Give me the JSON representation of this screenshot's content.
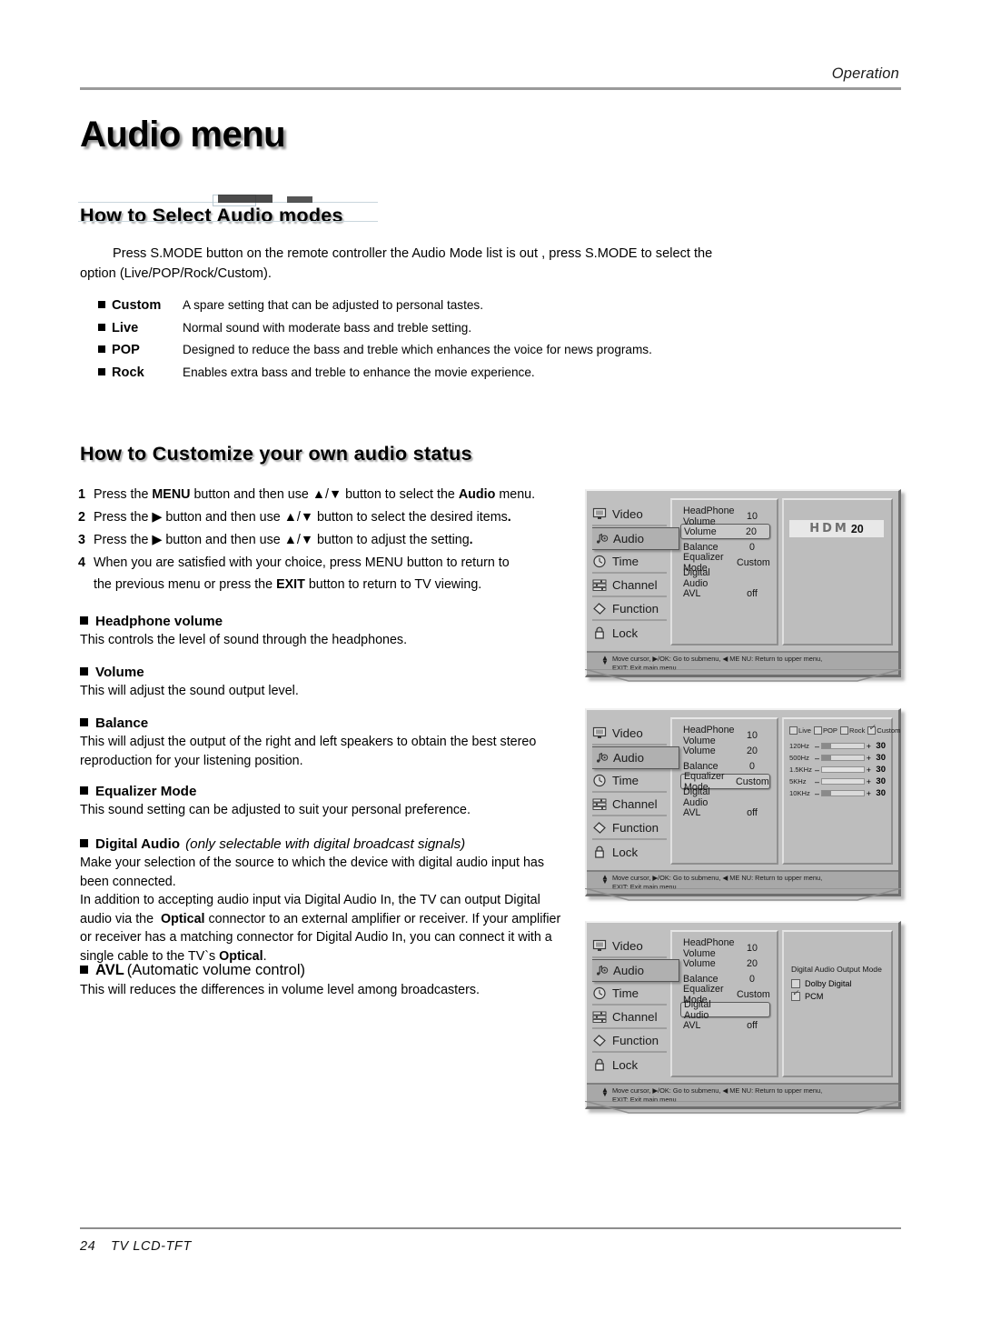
{
  "header": {
    "running_head": "Operation"
  },
  "page_title": "Audio menu",
  "sections": {
    "select_modes": {
      "heading": "How to Select Audio modes",
      "intro_line1": "Press S.MODE button on the remote controller the Audio Mode list is out , press S.MODE to select the",
      "intro_line2": "option (Live/POP/Rock/Custom).",
      "modes": [
        {
          "name": "Custom",
          "desc": "A spare setting that can be adjusted to personal tastes."
        },
        {
          "name": "Live",
          "desc": "Normal sound with moderate bass and treble setting."
        },
        {
          "name": "POP",
          "desc": "Designed to reduce the bass and treble which enhances the voice for news programs."
        },
        {
          "name": "Rock",
          "desc": "Enables extra bass and treble to enhance the movie experience."
        }
      ]
    },
    "customize": {
      "heading": "How to Customize your own audio status",
      "steps": [
        {
          "num": "1",
          "html": "Press the <b>MENU</b> button and then use ▲/▼ button to select the <b>Audio</b> menu."
        },
        {
          "num": "2",
          "html": "Press the ▶ button and then use ▲/▼ button to select the desired items<b>.</b>"
        },
        {
          "num": "3",
          "html": "Press the ▶ button and then use ▲/▼ button to adjust the setting<b>.</b>"
        },
        {
          "num": "4",
          "html": "When you are satisfied with your choice,  press MENU button to return to<br>the previous menu or press the <b>EXIT</b> button to return to TV viewing."
        }
      ]
    },
    "topics": {
      "headphone": {
        "title": "Headphone volume",
        "body": "This controls the level of sound through the headphones."
      },
      "volume": {
        "title": "Volume",
        "body": "This will adjust the sound output level."
      },
      "balance": {
        "title": "Balance",
        "body": "This will adjust the output of the right and left speakers to obtain the best stereo reproduction for your listening position."
      },
      "equalizer": {
        "title": "Equalizer Mode",
        "body": "This sound setting can be adjusted to suit your personal preference."
      },
      "digital": {
        "title": "Digital Audio",
        "note": "(only selectable with digital broadcast signals)",
        "body_html": "Make your selection of the source to which the device with digital audio input has been connected.<br>In addition to accepting audio input via Digital Audio In, the TV can output Digital audio via the&nbsp; <b>Optical</b> connector to an external amplifier or receiver. If your amplifier or receiver has a matching connector for Digital Audio In, you can connect it with a single cable to the TV`s <b>Optical</b>."
      },
      "avl": {
        "title": "AVL",
        "title_plain": "(Automatic volume control)",
        "body": "This will reduces the differences in volume level among broadcasters."
      }
    }
  },
  "osd": {
    "nav": [
      {
        "label": "Video",
        "icon": "monitor-icon"
      },
      {
        "label": "Audio",
        "icon": "music-note-icon"
      },
      {
        "label": "Time",
        "icon": "clock-icon"
      },
      {
        "label": "Channel",
        "icon": "sliders-icon"
      },
      {
        "label": "Function",
        "icon": "tag-icon"
      },
      {
        "label": "Lock",
        "icon": "lock-icon"
      }
    ],
    "settings": [
      {
        "label": "HeadPhone Volume",
        "value": "10"
      },
      {
        "label": "Volume",
        "value": "20"
      },
      {
        "label": "Balance",
        "value": "0"
      },
      {
        "label": "Equalizer Mode",
        "value": "Custom"
      },
      {
        "label": "Digital Audio",
        "value": ""
      },
      {
        "label": "AVL",
        "value": "off"
      }
    ],
    "hint_line1": "Move cursor,  ▶/OK: Go to submenu,  ◀ ME NU: Return to upper menu,",
    "hint_line2": "EXIT: Exit main menu",
    "screen1": {
      "selected_row": "Volume",
      "badge_text": "HDM",
      "badge_number": "20"
    },
    "screen2": {
      "selected_row": "Equalizer Mode",
      "eq_modes": [
        {
          "label": "Live",
          "checked": false
        },
        {
          "label": "POP",
          "checked": false
        },
        {
          "label": "Rock",
          "checked": false
        },
        {
          "label": "Custom",
          "checked": true
        }
      ],
      "eq_bands": [
        {
          "freq": "120Hz",
          "value": "30"
        },
        {
          "freq": "500Hz",
          "value": "30"
        },
        {
          "freq": "1.5KHz",
          "value": "30"
        },
        {
          "freq": "5KHz",
          "value": "30"
        },
        {
          "freq": "10KHz",
          "value": "30"
        }
      ]
    },
    "screen3": {
      "selected_row": "Digital Audio",
      "output_title": "Digital Audio Output Mode",
      "options": [
        {
          "label": "Dolby Digital",
          "checked": false
        },
        {
          "label": "PCM",
          "checked": true
        }
      ]
    }
  },
  "footer": {
    "page_number": "24",
    "product": "TV LCD-TFT"
  },
  "colors": {
    "osd_bg": "#c0c0c0",
    "osd_panel": "#bdbdbd",
    "rule": "#9a9a9a"
  }
}
